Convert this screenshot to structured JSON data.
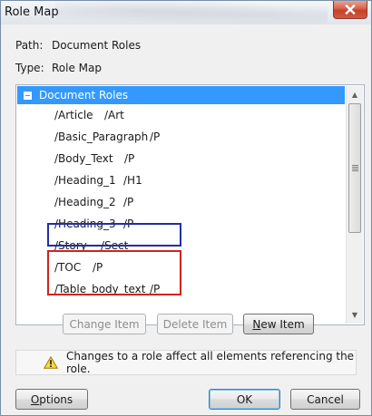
{
  "window": {
    "title": "Role Map",
    "close_icon": "close-icon"
  },
  "info": {
    "path_label": "Path:",
    "path_value": "Document Roles",
    "type_label": "Type:",
    "type_value": "Role Map"
  },
  "list": {
    "header": "Document Roles",
    "items": [
      {
        "tag": "/Article",
        "role": "/Art"
      },
      {
        "tag": "/Basic_Paragraph",
        "role": "/P"
      },
      {
        "tag": "/Body_Text",
        "role": "/P"
      },
      {
        "tag": "/Heading_1",
        "role": "/H1"
      },
      {
        "tag": "/Heading_2",
        "role": "/P"
      },
      {
        "tag": "/Heading_3",
        "role": "/P"
      },
      {
        "tag": "/Story",
        "role": "/Sect"
      },
      {
        "tag": "/TOC",
        "role": "/P"
      },
      {
        "tag": "/Table_body_text",
        "role": "/P"
      }
    ],
    "highlight_colors": {
      "blue": "#1f2fa8",
      "red": "#d0231c"
    },
    "selection_color": "#3399ff"
  },
  "buttons": {
    "change_item": "Change Item",
    "delete_item": "Delete Item",
    "new_item_first": "N",
    "new_item_rest": "ew Item",
    "options_first": "O",
    "options_rest": "ptions",
    "ok": "OK",
    "cancel": "Cancel"
  },
  "notice": {
    "icon": "warning-icon",
    "text": "Changes to a role affect all elements referencing the role."
  }
}
